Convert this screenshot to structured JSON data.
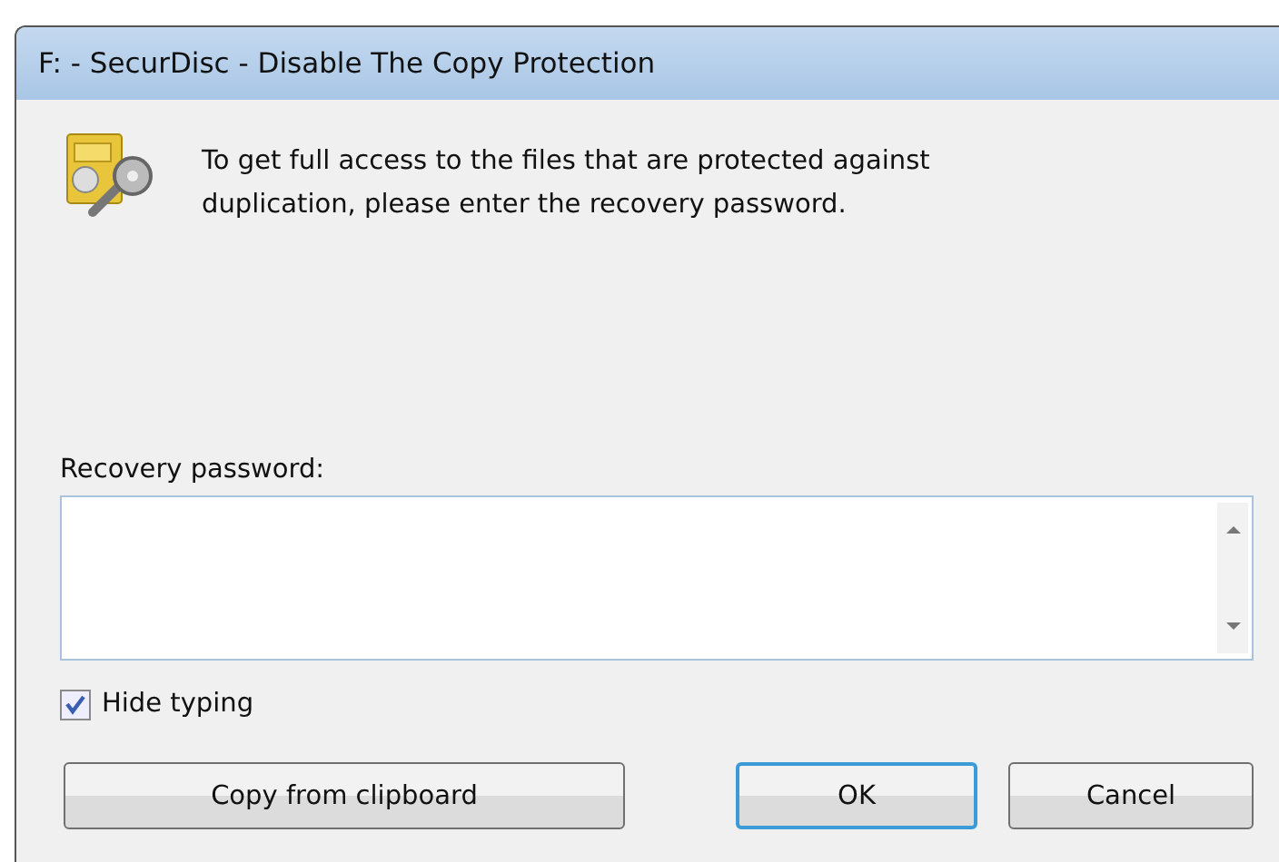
{
  "window": {
    "title": "F: - SecurDisc - Disable The Copy Protection"
  },
  "message": "To get full access to the files that are protected against duplication, please enter the recovery password.",
  "password_label": "Recovery password:",
  "hide_typing": {
    "label": "Hide typing",
    "checked": true
  },
  "buttons": [
    {
      "label": "Copy from clipboard",
      "kind": "wide",
      "focused": false
    },
    {
      "label": "OK",
      "kind": "default",
      "focused": true
    },
    {
      "label": "Cancel",
      "kind": "normal",
      "focused": false
    }
  ]
}
